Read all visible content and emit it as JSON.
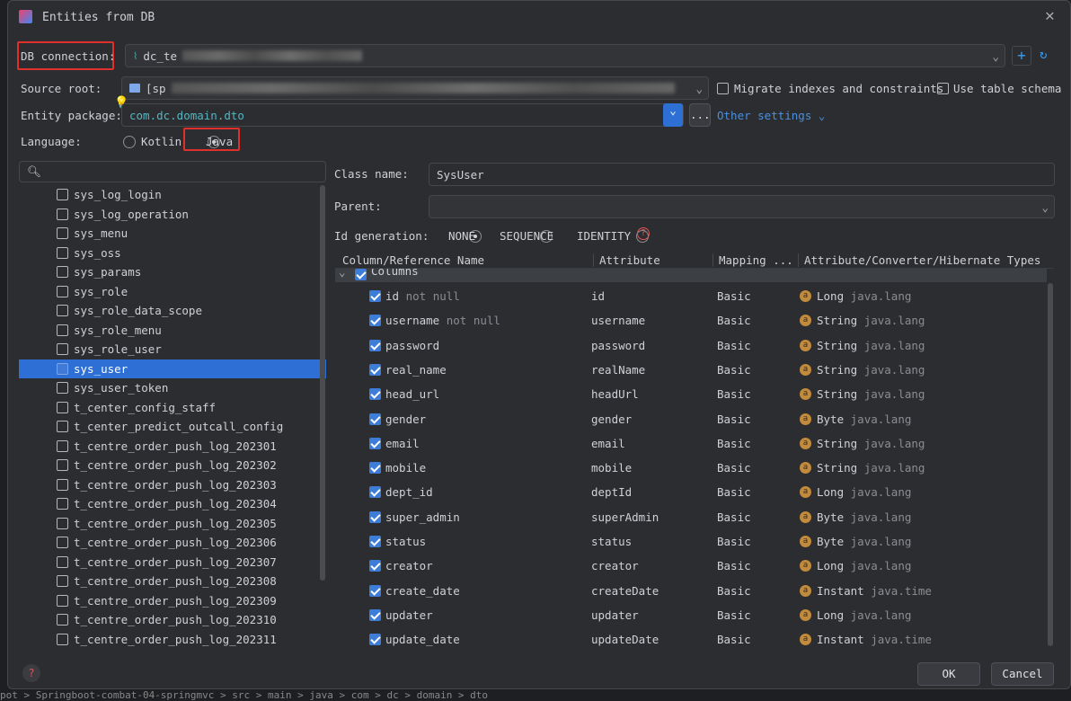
{
  "title": "Entities from DB",
  "db_connection": {
    "label": "DB connection:",
    "value": "dc_te"
  },
  "source_root": {
    "label": "Source root:",
    "value": "[sp"
  },
  "entity_package": {
    "label": "Entity package:",
    "value": "com.dc.domain.dto",
    "more": "...",
    "other_settings": "Other settings"
  },
  "options": {
    "migrate": "Migrate indexes and constraints",
    "use_schema": "Use table schema"
  },
  "language": {
    "label": "Language:",
    "kotlin": "Kotlin",
    "java": "Java"
  },
  "class_name": {
    "label": "Class name:",
    "value": "SysUser"
  },
  "parent": {
    "label": "Parent:",
    "value": ""
  },
  "id_generation": {
    "label": "Id generation:",
    "none": "NONE",
    "sequence": "SEQUENCE",
    "identity": "IDENTITY"
  },
  "table_headers": [
    "Column/Reference Name",
    "Attribute",
    "Mapping ...",
    "Attribute/Converter/Hibernate Types"
  ],
  "group": "Columns",
  "tables": [
    "sys_log_login",
    "sys_log_operation",
    "sys_menu",
    "sys_oss",
    "sys_params",
    "sys_role",
    "sys_role_data_scope",
    "sys_role_menu",
    "sys_role_user",
    "sys_user",
    "sys_user_token",
    "t_center_config_staff",
    "t_center_predict_outcall_config",
    "t_centre_order_push_log_202301",
    "t_centre_order_push_log_202302",
    "t_centre_order_push_log_202303",
    "t_centre_order_push_log_202304",
    "t_centre_order_push_log_202305",
    "t_centre_order_push_log_202306",
    "t_centre_order_push_log_202307",
    "t_centre_order_push_log_202308",
    "t_centre_order_push_log_202309",
    "t_centre_order_push_log_202310",
    "t_centre_order_push_log_202311"
  ],
  "selected_table": "sys_user",
  "columns": [
    {
      "name": "id",
      "note": "not null",
      "attr": "id",
      "mapping": "Basic",
      "type": "Long",
      "pkg": "java.lang"
    },
    {
      "name": "username",
      "note": "not null",
      "attr": "username",
      "mapping": "Basic",
      "type": "String",
      "pkg": "java.lang"
    },
    {
      "name": "password",
      "note": "",
      "attr": "password",
      "mapping": "Basic",
      "type": "String",
      "pkg": "java.lang"
    },
    {
      "name": "real_name",
      "note": "",
      "attr": "realName",
      "mapping": "Basic",
      "type": "String",
      "pkg": "java.lang"
    },
    {
      "name": "head_url",
      "note": "",
      "attr": "headUrl",
      "mapping": "Basic",
      "type": "String",
      "pkg": "java.lang"
    },
    {
      "name": "gender",
      "note": "",
      "attr": "gender",
      "mapping": "Basic",
      "type": "Byte",
      "pkg": "java.lang"
    },
    {
      "name": "email",
      "note": "",
      "attr": "email",
      "mapping": "Basic",
      "type": "String",
      "pkg": "java.lang"
    },
    {
      "name": "mobile",
      "note": "",
      "attr": "mobile",
      "mapping": "Basic",
      "type": "String",
      "pkg": "java.lang"
    },
    {
      "name": "dept_id",
      "note": "",
      "attr": "deptId",
      "mapping": "Basic",
      "type": "Long",
      "pkg": "java.lang"
    },
    {
      "name": "super_admin",
      "note": "",
      "attr": "superAdmin",
      "mapping": "Basic",
      "type": "Byte",
      "pkg": "java.lang"
    },
    {
      "name": "status",
      "note": "",
      "attr": "status",
      "mapping": "Basic",
      "type": "Byte",
      "pkg": "java.lang"
    },
    {
      "name": "creator",
      "note": "",
      "attr": "creator",
      "mapping": "Basic",
      "type": "Long",
      "pkg": "java.lang"
    },
    {
      "name": "create_date",
      "note": "",
      "attr": "createDate",
      "mapping": "Basic",
      "type": "Instant",
      "pkg": "java.time"
    },
    {
      "name": "updater",
      "note": "",
      "attr": "updater",
      "mapping": "Basic",
      "type": "Long",
      "pkg": "java.lang"
    },
    {
      "name": "update_date",
      "note": "",
      "attr": "updateDate",
      "mapping": "Basic",
      "type": "Instant",
      "pkg": "java.time"
    }
  ],
  "buttons": {
    "ok": "OK",
    "cancel": "Cancel"
  },
  "breadcrumb": "pot  >  Springboot-combat-04-springmvc  >  src  >  main  >  java  >  com  >  dc  >  domain  >  dto"
}
